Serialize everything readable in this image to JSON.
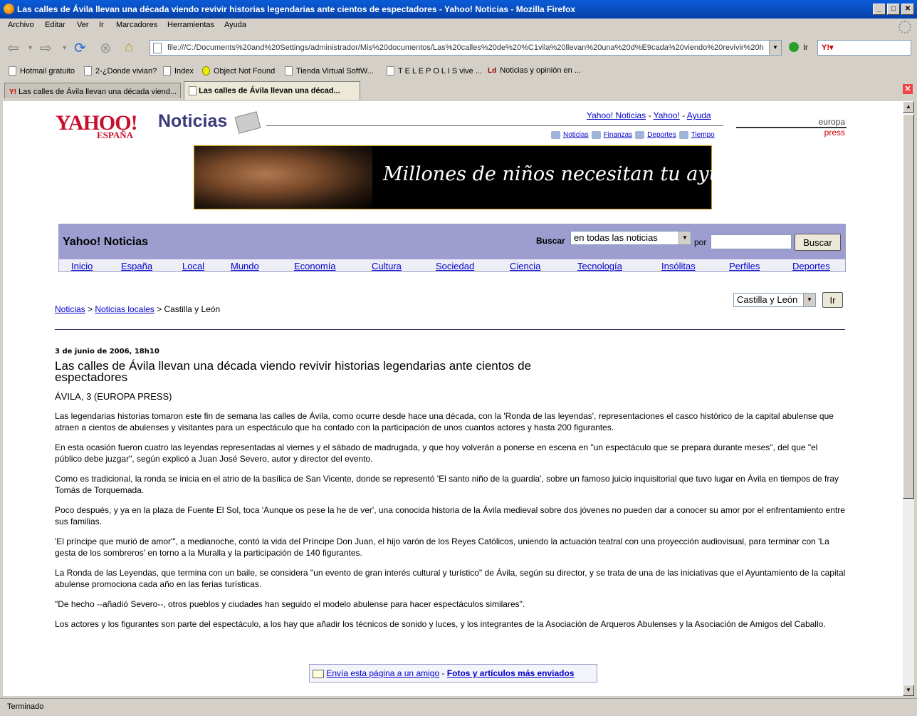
{
  "window": {
    "title": "Las calles de Ávila llevan una década viendo revivir historias legendarias ante cientos de espectadores - Yahoo! Noticias - Mozilla Firefox"
  },
  "menu": [
    "Archivo",
    "Editar",
    "Ver",
    "Ir",
    "Marcadores",
    "Herramientas",
    "Ayuda"
  ],
  "toolbar": {
    "url": "file:///C:/Documents%20and%20Settings/administrador/Mis%20documentos/Las%20calles%20de%20%C1vila%20llevan%20una%20d%E9cada%20viendo%20revivir%20h",
    "go_label": "Ir"
  },
  "bookmarks": [
    "Hotmail gratuito",
    "2-¿Donde vivian?",
    "Index",
    "Object Not Found",
    "Tienda Virtual SoftW...",
    "T E L E P O L I S vive ...",
    "Noticias y opinión en ..."
  ],
  "tabs": [
    "Las calles de Ávila llevan una década viend...",
    "Las calles de Ávila llevan una décad..."
  ],
  "page": {
    "logo_text": "YAHOO!",
    "logo_sub": "ESPAÑA",
    "section_title": "Noticias",
    "top_links": [
      "Yahoo! Noticias",
      "Yahoo!",
      "Ayuda"
    ],
    "sub_links": [
      "Noticias",
      "Finanzas",
      "Deportes",
      "Tiempo"
    ],
    "ep_line1": "europa",
    "ep_line2": "press",
    "banner_text": "Millones de niños necesitan tu ayuda",
    "nav_title": "Yahoo! Noticias",
    "search_label": "Buscar",
    "search_scope": "en todas las noticias",
    "por_label": "por",
    "search_button": "Buscar",
    "nav_items": [
      "Inicio",
      "España",
      "Local",
      "Mundo",
      "Economía",
      "Cultura",
      "Sociedad",
      "Ciencia",
      "Tecnología",
      "Insólitas",
      "Perfiles",
      "Deportes"
    ],
    "region_select": "Castilla y León",
    "region_go": "Ir",
    "breadcrumb": {
      "link1": "Noticias",
      "link2": "Noticias locales",
      "current": "Castilla y León"
    },
    "article": {
      "date": "3 de junio de 2006, 18h10",
      "headline": "Las calles de Ávila llevan una década viendo revivir historias legendarias ante cientos de espectadores",
      "dateline": "ÁVILA, 3 (EUROPA PRESS)",
      "paragraphs": [
        "Las legendarias historias tomaron este fin de semana las calles de Ávila, como ocurre desde hace una década, con la 'Ronda de las leyendas', representaciones el casco histórico de la capital abulense que atraen a cientos de abulenses y visitantes para un espectáculo que ha contado con la participación de unos cuantos actores y hasta 200 figurantes.",
        "En esta ocasión fueron cuatro las leyendas representadas al viernes y el sábado de madrugada, y que hoy volverán a ponerse en escena en \"un espectáculo que se prepara durante meses\",  del que \"el público debe juzgar\", según explicó a Juan José Severo, autor y director del evento.",
        "Como es tradicional, la ronda se inicia en el atrio de la basílica de San Vicente, donde se representó 'El santo niño de la guardia', sobre un famoso juicio inquisitorial que tuvo lugar en Ávila en tiempos de fray Tomás de Torquemada.",
        "Poco después, y ya en la plaza de Fuente El Sol, toca 'Aunque os pese la he de ver', una conocida historia de la Ávila medieval sobre dos jóvenes no pueden dar a conocer su amor por el enfrentamiento entre sus familias.",
        "'El príncipe que murió de amor'\", a medianoche, contó la vida del Príncipe Don Juan, el hijo varón de los Reyes Católicos, uniendo la actuación teatral con una proyección audiovisual, para terminar con 'La gesta de los sombreros' en torno a la Muralla y la participación de 140 figurantes.",
        "La Ronda de las Leyendas, que termina con un baile, se considera \"un evento de gran interés cultural y turístico\" de Ávila, según su director, y se trata de una de las iniciativas que el Ayuntamiento de la capital abulense promociona cada año en las ferias turísticas.",
        "\"De hecho --añadió Severo--, otros pueblos y ciudades han seguido el modelo abulense para hacer espectáculos similares\".",
        "Los actores y los figurantes son parte del espectáculo, a los hay que añadir los técnicos de sonido y luces, y los integrantes de la Asociación de Arqueros Abulenses y la Asociación de Amigos del Caballo."
      ]
    },
    "send_link": "Envía esta página a un amigo",
    "send_sep": " - ",
    "most_sent_link": "Fotos y artículos más enviados"
  },
  "status": "Terminado"
}
